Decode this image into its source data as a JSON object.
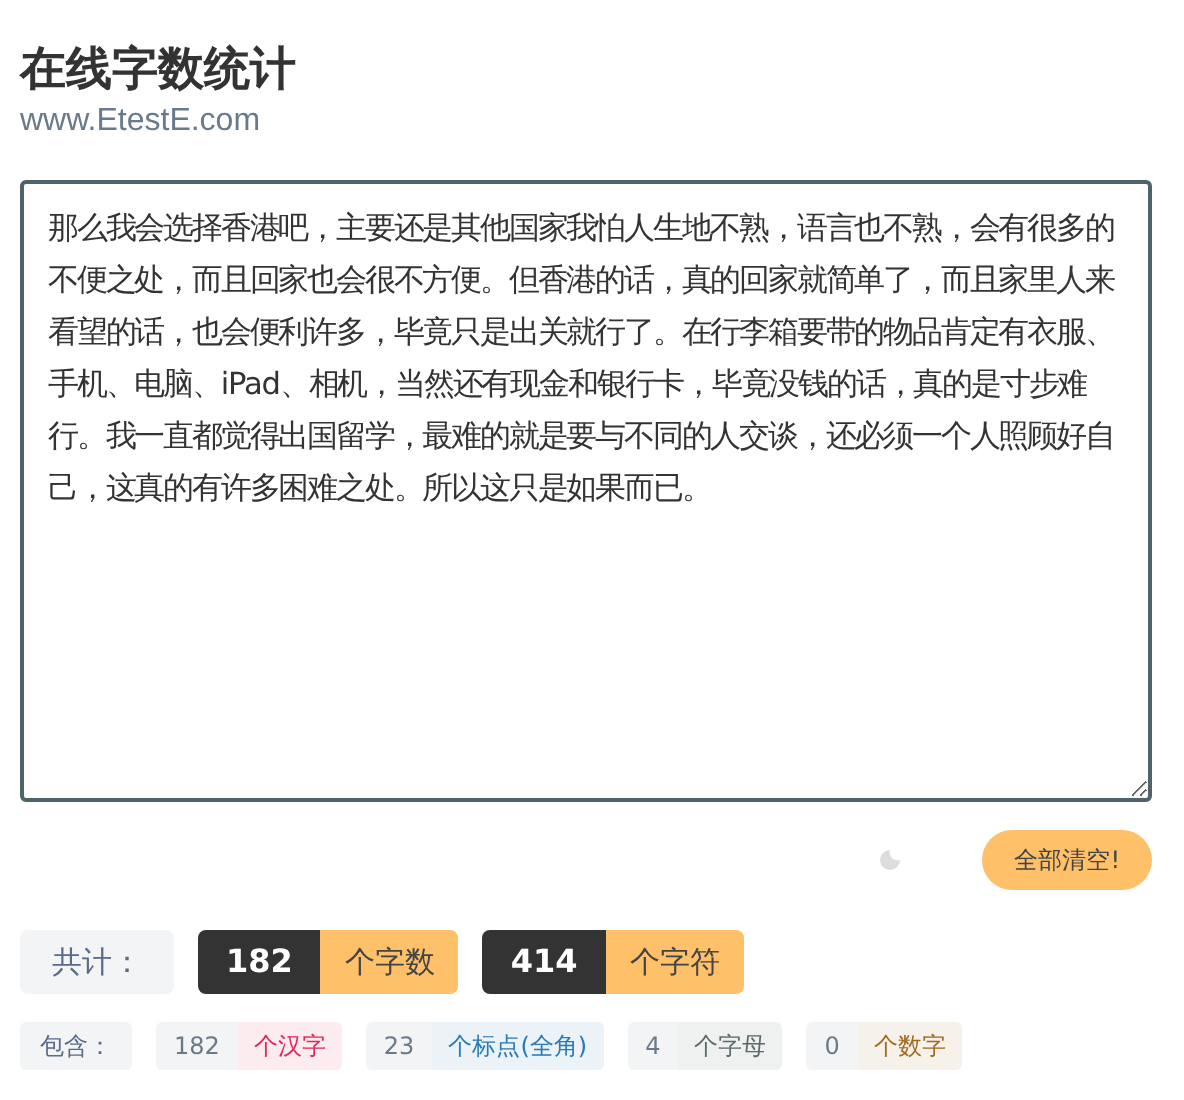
{
  "header": {
    "title": "在线字数统计",
    "site": "www.EtestE.com"
  },
  "editor": {
    "value": "那么我会选择香港吧，主要还是其他国家我怕人生地不熟，语言也不熟，会有很多的不便之处，而且回家也会很不方便。但香港的话，真的回家就简单了，而且家里人来看望的话，也会便利许多，毕竟只是出关就行了。在行李箱要带的物品肯定有衣服、手机、电脑、iPad、相机，当然还有现金和银行卡，毕竟没钱的话，真的是寸步难行。我一直都觉得出国留学，最难的就是要与不同的人交谈，还必须一个人照顾好自己，这真的有许多困难之处。所以这只是如果而已。"
  },
  "clear_button": "全部清空!",
  "totals": {
    "label": "共计：",
    "items": [
      {
        "count": "182",
        "unit": "个字数"
      },
      {
        "count": "414",
        "unit": "个字符"
      }
    ]
  },
  "breakdown": {
    "label": "包含：",
    "items": [
      {
        "count": "182",
        "unit": "个汉字",
        "color": "#e0285a"
      },
      {
        "count": "23",
        "unit": "个标点(全角)",
        "color": "#2a7ab8"
      },
      {
        "count": "4",
        "unit": "个字母",
        "color": "#5a6a6a"
      },
      {
        "count": "0",
        "unit": "个数字",
        "color": "#a06a20"
      }
    ]
  }
}
